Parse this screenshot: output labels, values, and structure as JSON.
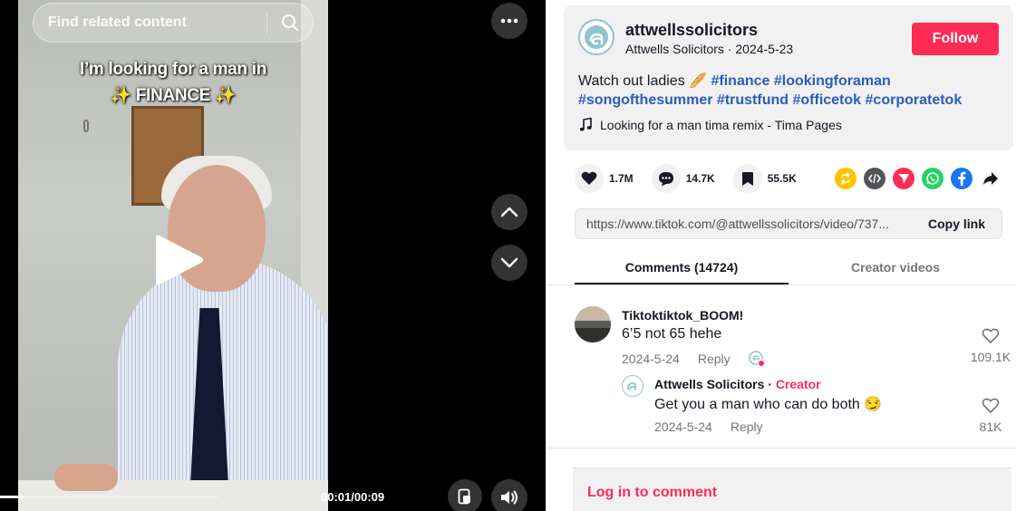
{
  "video": {
    "overlay_line1": "I’m looking for a man in",
    "overlay_line2": "✨ FINANCE ✨",
    "time": "00:01/00:09",
    "progress": 0.11
  },
  "search": {
    "placeholder": "Find related content"
  },
  "post": {
    "username": "attwellssolicitors",
    "display_name": "Attwells Solicitors",
    "date": "2024-5-23",
    "subline_sep": " · ",
    "follow_label": "Follow",
    "caption_text": "Watch out ladies 🥖 ",
    "hashtags": [
      "#finance",
      "#lookingforaman",
      "#songofthesummer",
      "#trustfund",
      "#officetok",
      "#corporatetok"
    ],
    "music": "Looking for a man tima remix - Tima Pages"
  },
  "stats": {
    "likes": "1.7M",
    "comments": "14.7K",
    "saves": "55.5K"
  },
  "share": {
    "url": "https://www.tiktok.com/@attwellssolicitors/video/737...",
    "copy_label": "Copy link"
  },
  "tabs": {
    "comments": "Comments (14724)",
    "creator": "Creator videos"
  },
  "comments": [
    {
      "name": "Tiktoktiktok_BOOM!",
      "text": "6’5 not 65 hehe",
      "date": "2024-5-24",
      "reply": "Reply",
      "likes": "109.1K"
    },
    {
      "name": "Attwells Solicitors",
      "sep": " · ",
      "creator_tag": "Creator",
      "text": "Get you a man who can do both 😏",
      "date": "2024-5-24",
      "reply": "Reply",
      "likes": "81K"
    }
  ],
  "login": {
    "label": "Log in to comment"
  },
  "colors": {
    "accent": "#fe2c55",
    "hashtag": "#2b5db9",
    "text": "#161823",
    "muted": "#73747b"
  },
  "icons": [
    "search-icon",
    "more-icon",
    "play-icon",
    "chevron-up-icon",
    "chevron-down-icon",
    "captions-icon",
    "volume-icon",
    "heart-icon",
    "comment-icon",
    "bookmark-icon",
    "music-note-icon",
    "repost-icon",
    "embed-icon",
    "send-icon",
    "whatsapp-icon",
    "facebook-icon",
    "share-arrow-icon"
  ]
}
